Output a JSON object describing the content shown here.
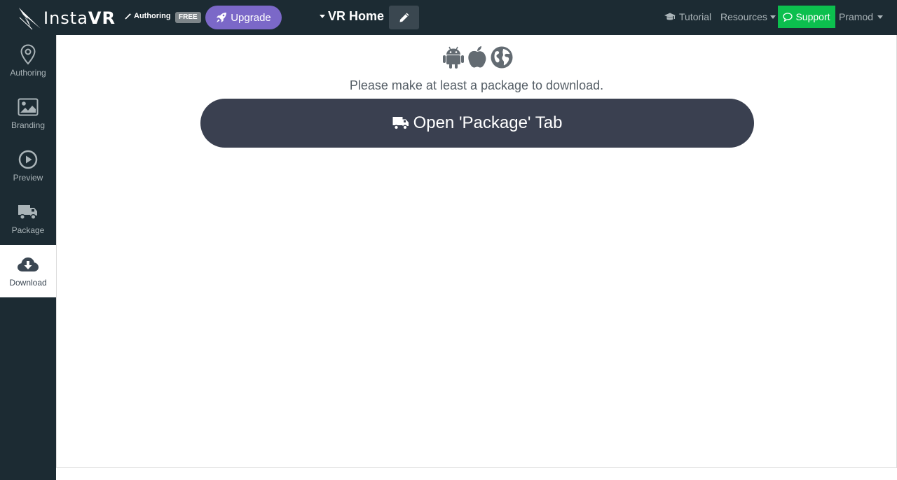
{
  "app": {
    "logo_text_light": "Insta",
    "logo_text_bold": "VR",
    "mode_label": "Authoring",
    "plan_badge": "FREE",
    "upgrade_label": "Upgrade"
  },
  "project": {
    "name": "VR Home"
  },
  "nav": {
    "tutorial_label": "Tutorial",
    "resources_label": "Resources",
    "support_label": "Support",
    "user_name": "Pramod"
  },
  "sidebar": {
    "items": [
      {
        "label": "Authoring",
        "icon": "map-pin-icon",
        "active": false
      },
      {
        "label": "Branding",
        "icon": "image-icon",
        "active": false
      },
      {
        "label": "Preview",
        "icon": "play-circle-icon",
        "active": false
      },
      {
        "label": "Package",
        "icon": "truck-icon",
        "active": false
      },
      {
        "label": "Download",
        "icon": "cloud-download-icon",
        "active": true
      }
    ]
  },
  "main": {
    "platform_icons": [
      "android-icon",
      "apple-icon",
      "globe-icon"
    ],
    "message": "Please make at least a package to download.",
    "open_package_label": "Open 'Package' Tab"
  },
  "colors": {
    "topbar_bg": "#1c2b33",
    "upgrade_bg": "#7b68c8",
    "support_bg": "#0cbf4e",
    "primary_button_bg": "#3a4050"
  }
}
